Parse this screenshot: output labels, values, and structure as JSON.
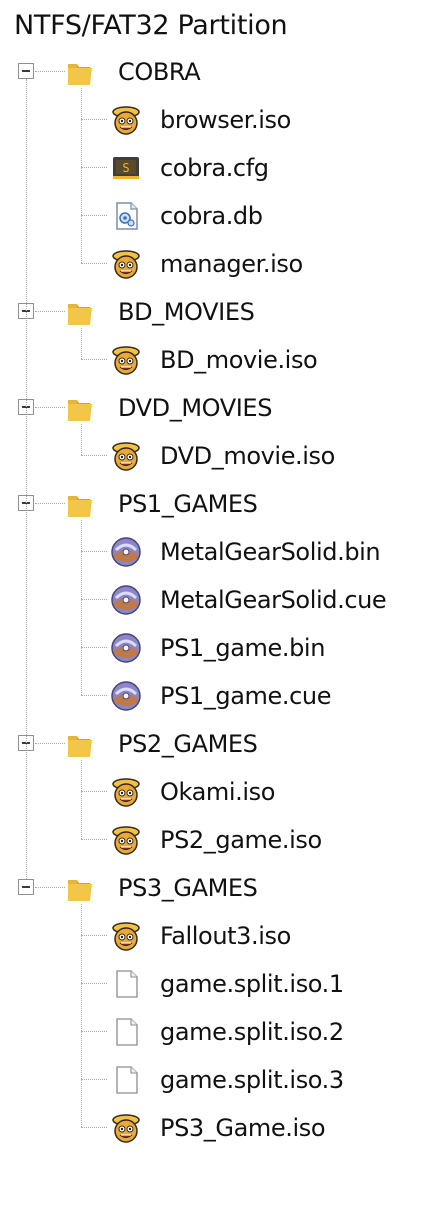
{
  "tree": {
    "root_label": "NTFS/FAT32 Partition",
    "folders": [
      {
        "name": "COBRA",
        "files": [
          {
            "name": "browser.iso",
            "icon": "disc-mascot-icon"
          },
          {
            "name": "cobra.cfg",
            "icon": "config-file-icon"
          },
          {
            "name": "cobra.db",
            "icon": "database-file-icon"
          },
          {
            "name": "manager.iso",
            "icon": "disc-mascot-icon"
          }
        ]
      },
      {
        "name": "BD_MOVIES",
        "files": [
          {
            "name": "BD_movie.iso",
            "icon": "disc-mascot-icon"
          }
        ]
      },
      {
        "name": "DVD_MOVIES",
        "files": [
          {
            "name": "DVD_movie.iso",
            "icon": "disc-mascot-icon"
          }
        ]
      },
      {
        "name": "PS1_GAMES",
        "files": [
          {
            "name": "MetalGearSolid.bin",
            "icon": "disc-image-icon"
          },
          {
            "name": "MetalGearSolid.cue",
            "icon": "disc-image-icon"
          },
          {
            "name": "PS1_game.bin",
            "icon": "disc-image-icon"
          },
          {
            "name": "PS1_game.cue",
            "icon": "disc-image-icon"
          }
        ]
      },
      {
        "name": "PS2_GAMES",
        "files": [
          {
            "name": "Okami.iso",
            "icon": "disc-mascot-icon"
          },
          {
            "name": "PS2_game.iso",
            "icon": "disc-mascot-icon"
          }
        ]
      },
      {
        "name": "PS3_GAMES",
        "files": [
          {
            "name": "Fallout3.iso",
            "icon": "disc-mascot-icon"
          },
          {
            "name": "game.split.iso.1",
            "icon": "blank-file-icon"
          },
          {
            "name": "game.split.iso.2",
            "icon": "blank-file-icon"
          },
          {
            "name": "game.split.iso.3",
            "icon": "blank-file-icon"
          },
          {
            "name": "PS3_Game.iso",
            "icon": "disc-mascot-icon"
          }
        ]
      }
    ]
  },
  "colors": {
    "folder": "#f3c64a",
    "folder_dark": "#d9a22c",
    "tree_line": "#a8a8a8",
    "text": "#111111"
  }
}
